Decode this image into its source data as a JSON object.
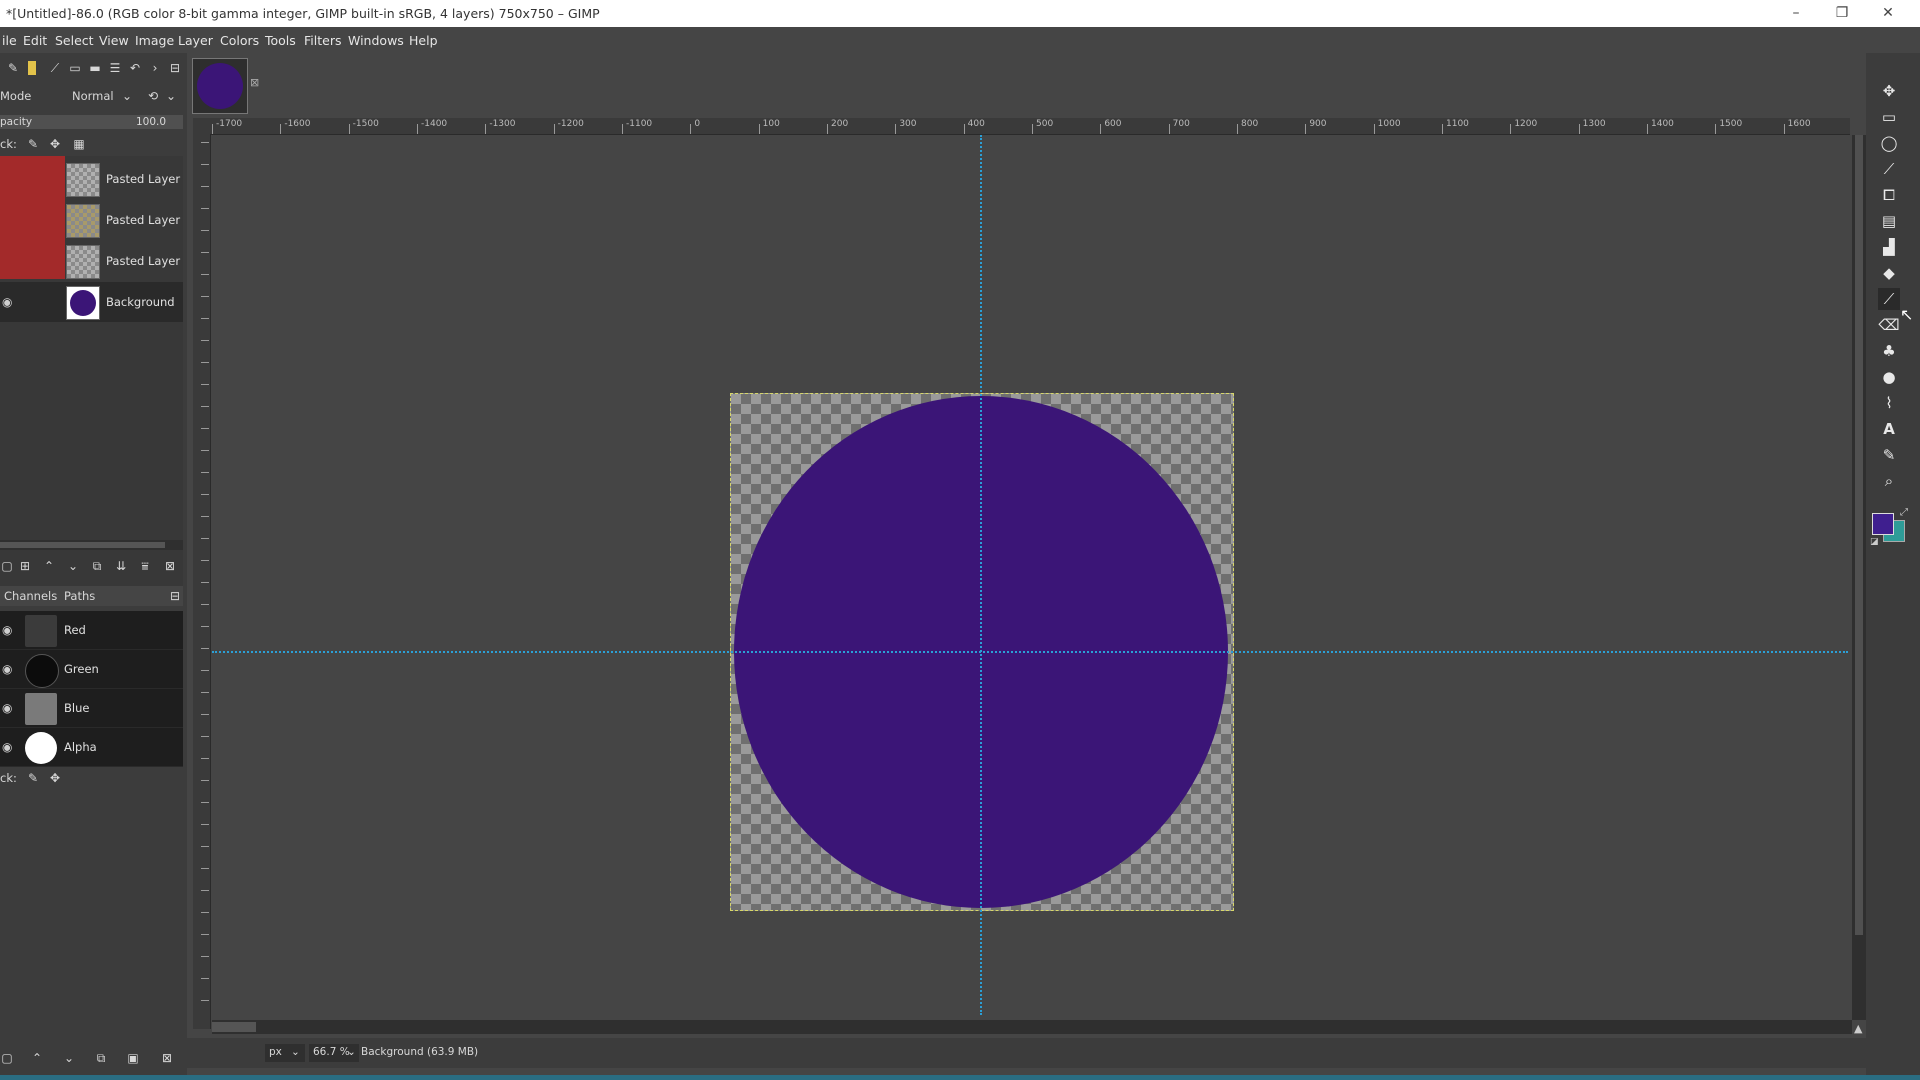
{
  "window": {
    "title": "*[Untitled]-86.0 (RGB color 8-bit gamma integer, GIMP built-in sRGB, 4 layers) 750x750 – GIMP",
    "minimize": "–",
    "maximize": "❐",
    "close": "✕"
  },
  "menu": [
    "ile",
    "Edit",
    "Select",
    "View",
    "Image",
    "Layer",
    "Colors",
    "Tools",
    "Filters",
    "Windows",
    "Help"
  ],
  "layers_panel": {
    "mode_label": "Mode",
    "mode_value": "Normal",
    "opacity_label": "pacity",
    "opacity_value": "100.0",
    "lock_label": "ck:",
    "layers": [
      {
        "name": "Pasted Layer"
      },
      {
        "name": "Pasted Layer"
      },
      {
        "name": "Pasted Layer"
      },
      {
        "name": "Background"
      }
    ]
  },
  "channels_panel": {
    "tab_channels": "Channels",
    "tab_paths": "Paths",
    "channels": [
      {
        "name": "Red"
      },
      {
        "name": "Green"
      },
      {
        "name": "Blue"
      },
      {
        "name": "Alpha"
      }
    ],
    "lock_label": "ck:"
  },
  "ruler": {
    "top_labels": [
      "-1700",
      "-1600",
      "-1500",
      "-1400",
      "-1300",
      "-1200",
      "-1100",
      "0",
      "100",
      "200",
      "300",
      "400",
      "500",
      "600",
      "700",
      "800",
      "900",
      "1000",
      "1100",
      "1200",
      "1300",
      "1400",
      "1500",
      "1600"
    ]
  },
  "status": {
    "unit": "px",
    "zoom": "66.7 %",
    "info": "Background (63.9 MB)"
  },
  "colors": {
    "circle": "#3b1577",
    "foreground": "#3f1f8f",
    "background": "#2e9c98",
    "layer_mask_red": "#a32a2a"
  }
}
